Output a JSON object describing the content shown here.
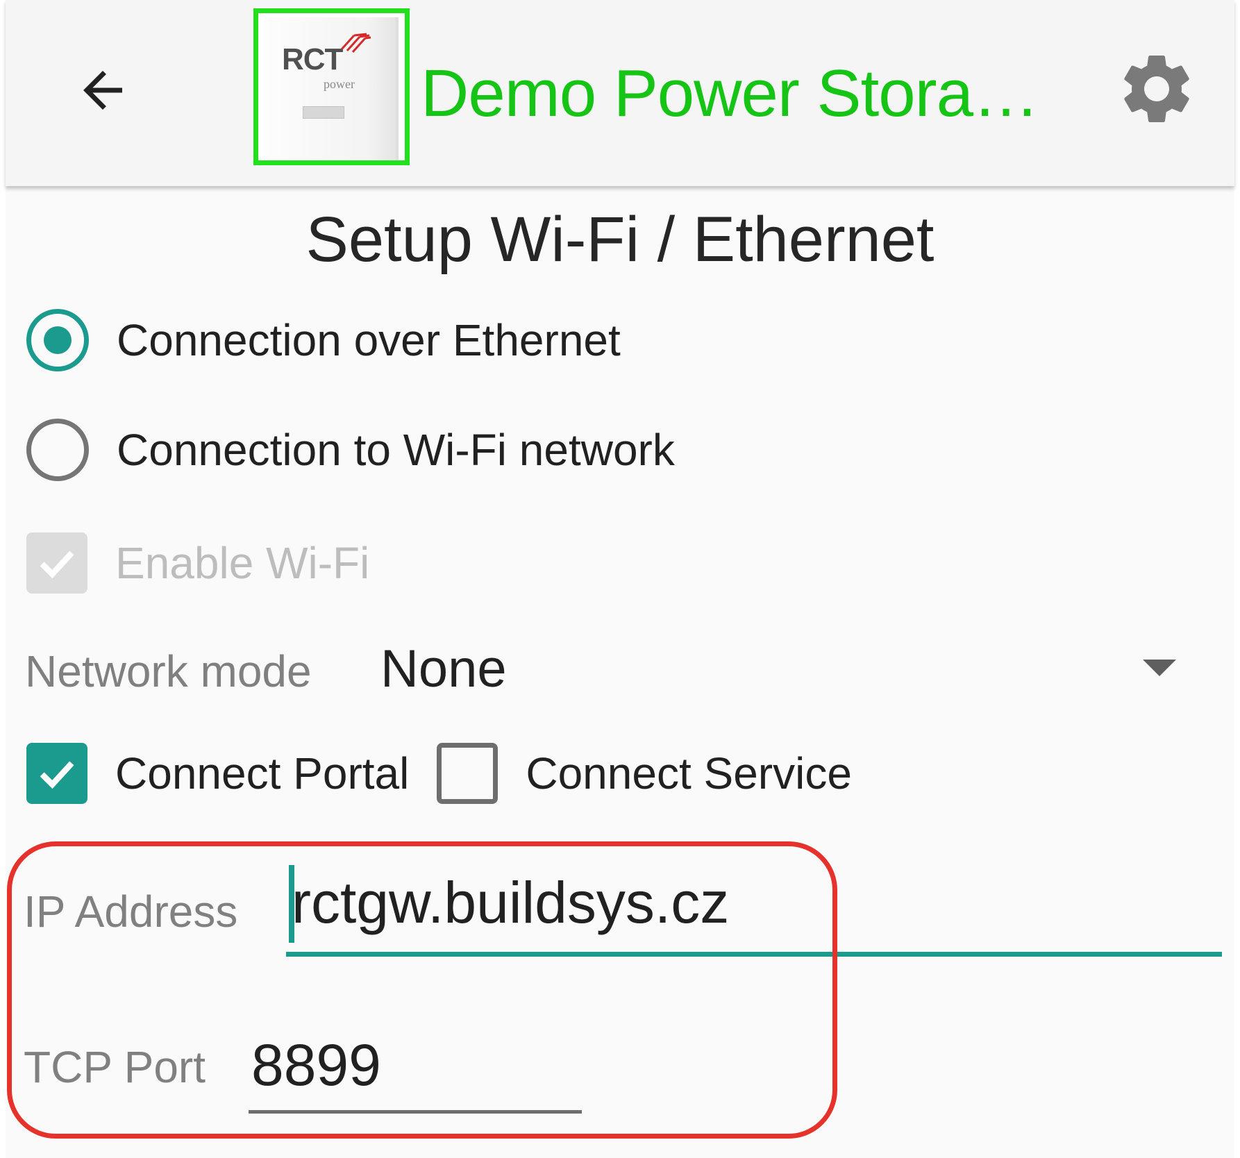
{
  "appbar": {
    "title": "Demo Power Stora…",
    "logo": {
      "brand": "RCT",
      "sub": "power"
    },
    "icons": {
      "back": "arrow-left-icon",
      "settings": "gear-icon"
    }
  },
  "page": {
    "title": "Setup Wi-Fi / Ethernet"
  },
  "connection": {
    "options": [
      {
        "label": "Connection over Ethernet",
        "selected": true
      },
      {
        "label": "Connection to Wi-Fi network",
        "selected": false
      }
    ],
    "enable_wifi": {
      "label": "Enable Wi-Fi",
      "checked": true,
      "disabled": true
    }
  },
  "network_mode": {
    "label": "Network mode",
    "value": "None"
  },
  "connect": {
    "portal": {
      "label": "Connect Portal",
      "checked": true
    },
    "service": {
      "label": "Connect Service",
      "checked": false
    }
  },
  "ip_address": {
    "label": "IP Address",
    "value": "rctgw.buildsys.cz"
  },
  "tcp_port": {
    "label": "TCP Port",
    "value": "8899"
  },
  "colors": {
    "accent": "#1b9a8e",
    "title_green": "#16c416",
    "logo_outline": "#22e01e",
    "highlight_red": "#e5322a"
  }
}
